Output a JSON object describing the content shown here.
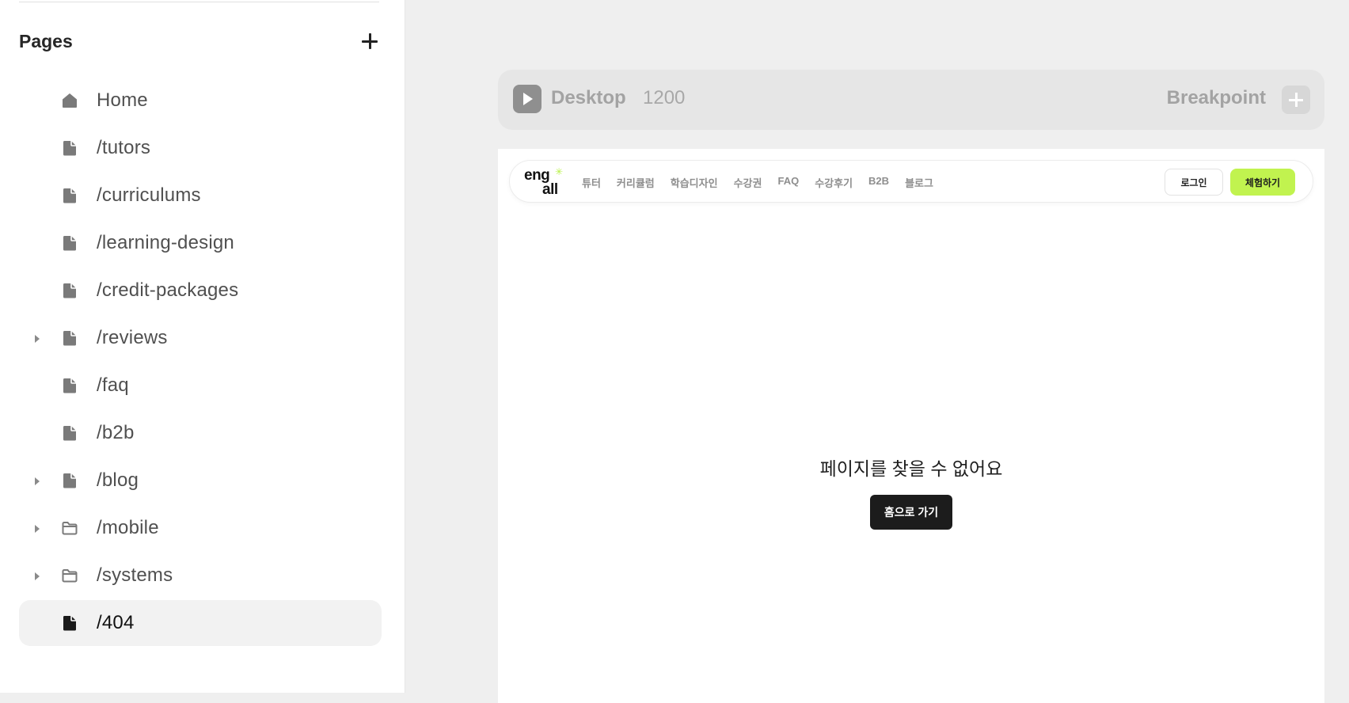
{
  "pages_panel": {
    "title": "Pages",
    "items": [
      {
        "label": "Home",
        "icon": "home-icon",
        "expandable": false,
        "active": false
      },
      {
        "label": "/tutors",
        "icon": "page-icon",
        "expandable": false,
        "active": false
      },
      {
        "label": "/curriculums",
        "icon": "page-icon",
        "expandable": false,
        "active": false
      },
      {
        "label": "/learning-design",
        "icon": "page-icon",
        "expandable": false,
        "active": false
      },
      {
        "label": "/credit-packages",
        "icon": "page-icon",
        "expandable": false,
        "active": false
      },
      {
        "label": "/reviews",
        "icon": "page-icon",
        "expandable": true,
        "active": false
      },
      {
        "label": "/faq",
        "icon": "page-icon",
        "expandable": false,
        "active": false
      },
      {
        "label": "/b2b",
        "icon": "page-icon",
        "expandable": false,
        "active": false
      },
      {
        "label": "/blog",
        "icon": "page-icon",
        "expandable": true,
        "active": false
      },
      {
        "label": "/mobile",
        "icon": "folder-icon",
        "expandable": true,
        "active": false
      },
      {
        "label": "/systems",
        "icon": "folder-icon",
        "expandable": true,
        "active": false
      },
      {
        "label": "/404",
        "icon": "page-icon",
        "expandable": false,
        "active": true
      }
    ]
  },
  "breakpoint_bar": {
    "name": "Desktop",
    "width": "1200",
    "label": "Breakpoint"
  },
  "site": {
    "logo_line1": "eng",
    "logo_line2": "all",
    "nav_links": [
      "튜터",
      "커리큘럼",
      "학습디자인",
      "수강권",
      "FAQ",
      "수강후기",
      "B2B",
      "블로그"
    ],
    "login_label": "로그인",
    "trial_label": "체험하기",
    "not_found_title": "페이지를 찾을 수 없어요",
    "home_button_label": "홈으로 가기"
  },
  "colors": {
    "accent_green": "#c1f34f",
    "dark_button": "#1c1c1c",
    "active_item_bg": "#f2f2f2"
  }
}
